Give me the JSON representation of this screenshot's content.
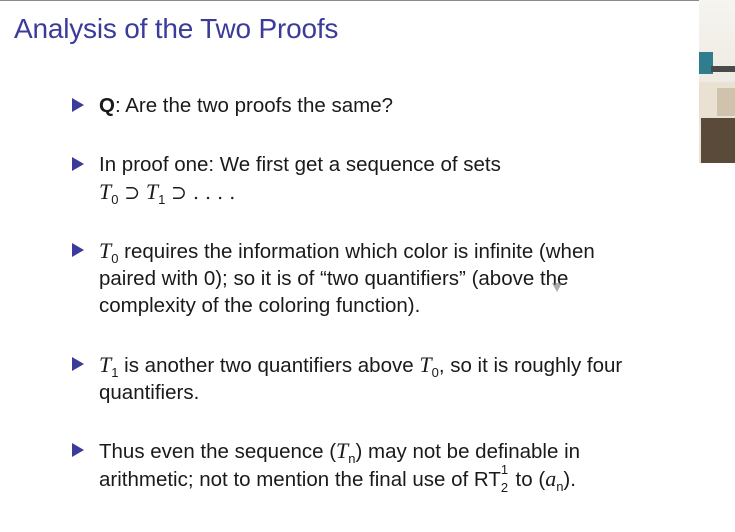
{
  "title": "Analysis of the Two Proofs",
  "bullets": {
    "b1": {
      "q": "Q",
      "rest": ": Are the two proofs the same?"
    },
    "b2": {
      "line1": "In proof one: We first get a sequence of sets",
      "t": "T",
      "s0": "0",
      "s1": "1",
      "sup": "⊃",
      "dots": "⊃ . . . ."
    },
    "b3": {
      "t": "T",
      "s0": "0",
      "line1": " requires the information which color is infinite (when",
      "line2": "paired with 0); so it is of “two quantifiers” (above the",
      "line3": "complexity of the coloring function)."
    },
    "b4": {
      "t": "T",
      "s1": "1",
      "mid": " is another two quantifiers above ",
      "s0": "0",
      "end": ", so it is roughly four",
      "line2": "quantifiers."
    },
    "b5": {
      "line1a": "Thus even the sequence (",
      "t": "T",
      "n": "n",
      "line1b": ") may not be definable in",
      "line2a": "arithmetic; not to mention the final use of RT",
      "sup": "1",
      "sub": "2",
      "line2b": " to (",
      "a": "a",
      "an": "n",
      "line2c": ")."
    }
  },
  "colors": {
    "title": "#3b3b9a",
    "bullet": "#3b3b9a",
    "text": "#1a1a1a"
  }
}
